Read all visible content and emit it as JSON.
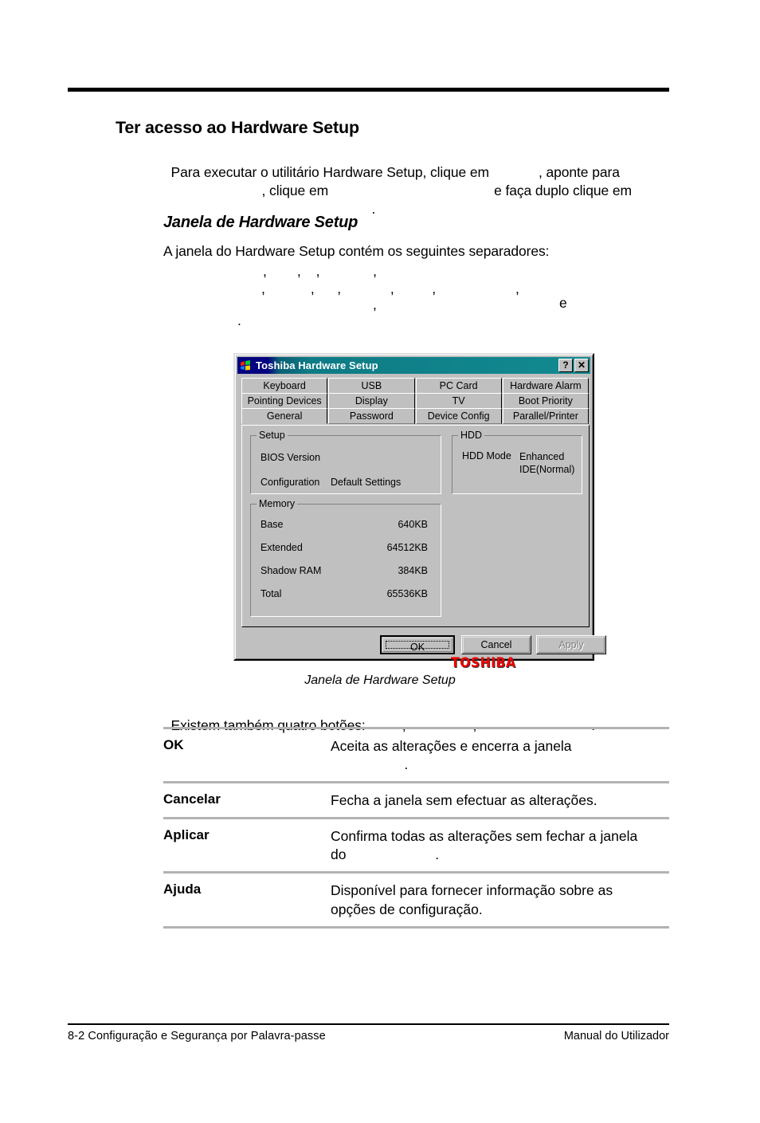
{
  "page": {
    "heading": "Ter acesso ao Hardware Setup",
    "subheading": "Janela de Hardware Setup",
    "intro": {
      "line1_a": "Para executar o utilitário Hardware Setup, clique em",
      "line1_b": ", aponte para",
      "line2_a": ", clique em",
      "line2_b": "e faça duplo clique em",
      "line3": "."
    },
    "tabs_intro": "A janela do Hardware Setup contém os seguintes separadores:",
    "tabs_list": {
      "line1": ",        ,    ,              ,",
      "line2": ",            ,      ,             ,          ,                     ,",
      "line3_comma": ",",
      "line3_e": "e",
      "line4": "."
    },
    "figure_caption": "Janela de Hardware Setup",
    "buttons_intro_a": "Existem também quatro botões:",
    "buttons_intro_b": ",",
    "buttons_intro_c": ",",
    "buttons_intro_d": "."
  },
  "deftable": {
    "rows": [
      {
        "term": "OK",
        "desc": "Aceita as alterações e encerra a janela\n                   ."
      },
      {
        "term": "Cancelar",
        "desc": "Fecha a janela sem efectuar as alterações."
      },
      {
        "term": "Aplicar",
        "desc": "Confirma todas as alterações sem fechar a janela\ndo                       ."
      },
      {
        "term": "Ajuda",
        "desc": "Disponível para fornecer informação sobre as\nopções de configuração."
      }
    ]
  },
  "dialog": {
    "title": "Toshiba Hardware Setup",
    "help_button": "?",
    "close_button": "✕",
    "tab_rows": [
      [
        {
          "label": "Keyboard",
          "selected": false
        },
        {
          "label": "USB",
          "selected": false
        },
        {
          "label": "PC Card",
          "selected": false
        },
        {
          "label": "Hardware Alarm",
          "selected": false
        }
      ],
      [
        {
          "label": "Pointing Devices",
          "selected": false
        },
        {
          "label": "Display",
          "selected": false
        },
        {
          "label": "TV",
          "selected": false
        },
        {
          "label": "Boot Priority",
          "selected": false
        }
      ],
      [
        {
          "label": "General",
          "selected": true
        },
        {
          "label": "Password",
          "selected": false
        },
        {
          "label": "Device Config",
          "selected": false
        },
        {
          "label": "Parallel/Printer",
          "selected": false
        }
      ]
    ],
    "groups": {
      "setup": {
        "label": "Setup",
        "rows": [
          {
            "name": "BIOS Version",
            "value": ""
          },
          {
            "name": "Configuration",
            "value": "Default Settings"
          }
        ]
      },
      "hdd": {
        "label": "HDD",
        "rows": [
          {
            "name": "HDD Mode",
            "value": "Enhanced\nIDE(Normal)"
          }
        ]
      },
      "memory": {
        "label": "Memory",
        "rows": [
          {
            "name": "Base",
            "value": "640KB"
          },
          {
            "name": "Extended",
            "value": "64512KB"
          },
          {
            "name": "Shadow RAM",
            "value": "384KB"
          },
          {
            "name": "Total",
            "value": "65536KB"
          }
        ]
      }
    },
    "brand": "TOSHIBA",
    "buttons": {
      "ok": "OK",
      "cancel": "Cancel",
      "apply": "Apply"
    }
  },
  "footer": {
    "left": "8-2  Configuração e Segurança por Palavra-passe",
    "right": "Manual do Utilizador"
  }
}
